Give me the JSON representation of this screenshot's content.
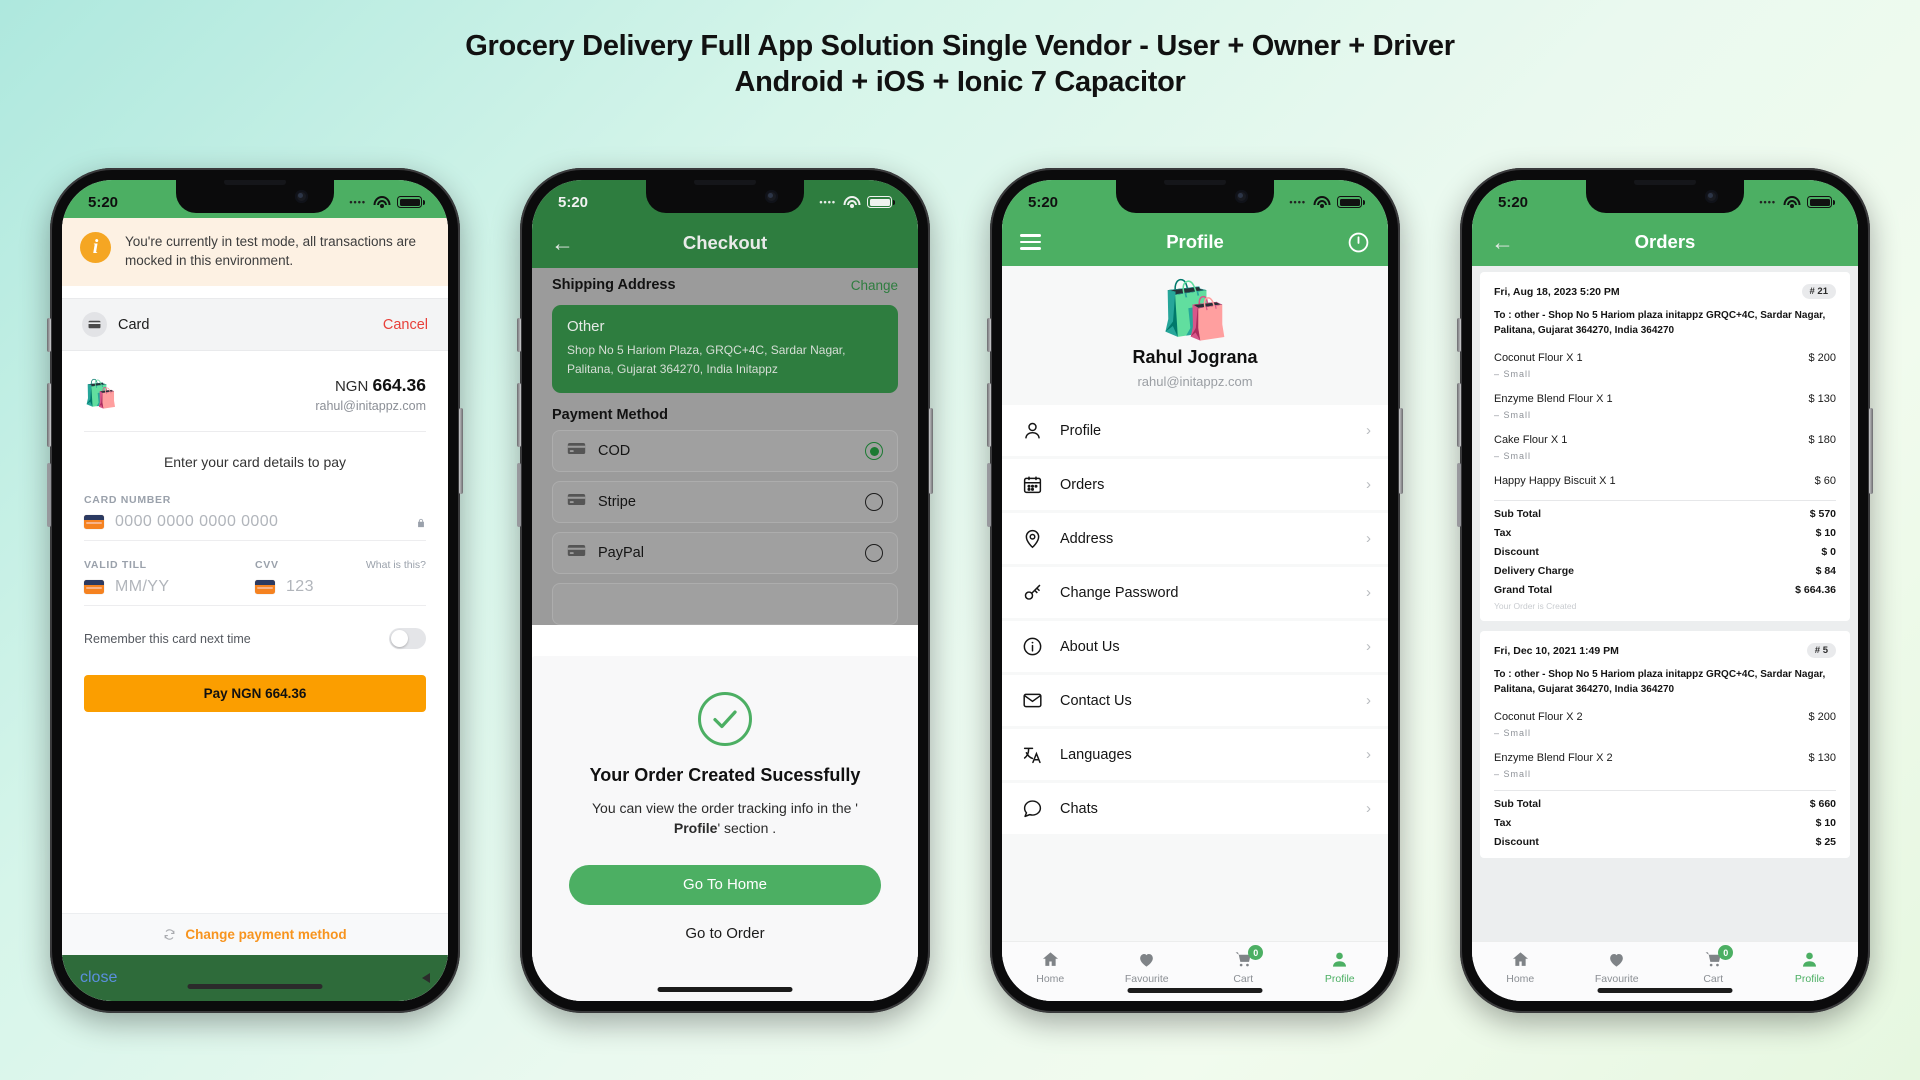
{
  "heading": {
    "line1": "Grocery Delivery Full App Solution Single Vendor - User + Owner + Driver",
    "line2": "Android + iOS + Ionic 7 Capacitor"
  },
  "colors": {
    "brand_green": "#4caf63",
    "dark_green": "#2e7d3f",
    "orange": "#fb9e00",
    "link_orange": "#f7941e",
    "red": "#e8403a"
  },
  "status_bar": {
    "time": "5:20"
  },
  "phone1": {
    "test_mode_notice": "You're currently in test mode, all transactions are mocked in this environment.",
    "method_label": "Card",
    "cancel_label": "Cancel",
    "currency": "NGN",
    "amount": "664.36",
    "email": "rahul@initappz.com",
    "enter_details": "Enter your card details to pay",
    "card_number_label": "CARD NUMBER",
    "card_number_placeholder": "0000 0000 0000 0000",
    "valid_till_label": "VALID TILL",
    "valid_till_placeholder": "MM/YY",
    "cvv_label": "CVV",
    "cvv_placeholder": "123",
    "what_is_this": "What is this?",
    "remember_label": "Remember this card next time",
    "pay_button": "Pay NGN 664.36",
    "change_payment_method": "Change payment method",
    "close_label": "close"
  },
  "phone2": {
    "title": "Checkout",
    "shipping_address_label": "Shipping Address",
    "change_label": "Change",
    "address": {
      "type": "Other",
      "line1": "Shop No 5 Hariom Plaza, GRQC+4C, Sardar Nagar,",
      "line2": "Palitana, Gujarat 364270, India Initappz"
    },
    "payment_method_label": "Payment Method",
    "payment_methods": [
      {
        "label": "COD",
        "selected": true
      },
      {
        "label": "Stripe",
        "selected": false
      },
      {
        "label": "PayPal",
        "selected": false
      }
    ],
    "modal": {
      "title": "Your Order Created Sucessfully",
      "body_1": "You can view the order tracking info in the '",
      "body_bold": "Profile",
      "body_2": "' section .",
      "primary_button": "Go To Home",
      "secondary_button": "Go to Order"
    }
  },
  "phone3": {
    "title": "Profile",
    "user_name": "Rahul Jograna",
    "user_email": "rahul@initappz.com",
    "menu": [
      {
        "label": "Profile",
        "icon": "user-icon"
      },
      {
        "label": "Orders",
        "icon": "calendar-icon"
      },
      {
        "label": "Address",
        "icon": "location-pin-icon"
      },
      {
        "label": "Change Password",
        "icon": "key-icon"
      },
      {
        "label": "About Us",
        "icon": "info-icon"
      },
      {
        "label": "Contact Us",
        "icon": "mail-icon"
      },
      {
        "label": "Languages",
        "icon": "translate-icon"
      },
      {
        "label": "Chats",
        "icon": "chat-icon"
      }
    ],
    "tabs": [
      {
        "label": "Home",
        "icon": "home-icon",
        "badge": "",
        "active": false
      },
      {
        "label": "Favourite",
        "icon": "heart-icon",
        "badge": "",
        "active": false
      },
      {
        "label": "Cart",
        "icon": "cart-icon",
        "badge": "0",
        "active": false
      },
      {
        "label": "Profile",
        "icon": "person-icon",
        "badge": "",
        "active": true
      }
    ]
  },
  "phone4": {
    "title": "Orders",
    "orders": [
      {
        "date": "Fri, Aug 18, 2023 5:20 PM",
        "number": "# 21",
        "to_line1": "To : other - Shop No 5 Hariom plaza initappz GRQC+4C, Sardar Nagar,",
        "to_line2": "Palitana, Gujarat 364270, India 364270",
        "items": [
          {
            "name": "Coconut Flour X 1",
            "size": "–  Small",
            "price": "$ 200"
          },
          {
            "name": "Enzyme Blend Flour X 1",
            "size": "–  Small",
            "price": "$ 130"
          },
          {
            "name": "Cake Flour X 1",
            "size": "–  Small",
            "price": "$ 180"
          },
          {
            "name": "Happy Happy Biscuit X 1",
            "size": "",
            "price": "$ 60"
          }
        ],
        "summary": [
          {
            "key": "Sub Total",
            "value": "$ 570"
          },
          {
            "key": "Tax",
            "value": "$ 10"
          },
          {
            "key": "Discount",
            "value": "$ 0"
          },
          {
            "key": "Delivery Charge",
            "value": "$ 84"
          },
          {
            "key": "Grand Total",
            "value": "$ 664.36"
          }
        ],
        "status": "Your Order is Created"
      },
      {
        "date": "Fri, Dec 10, 2021 1:49 PM",
        "number": "# 5",
        "to_line1": "To : other - Shop No 5 Hariom plaza initappz GRQC+4C, Sardar Nagar,",
        "to_line2": "Palitana, Gujarat 364270, India 364270",
        "items": [
          {
            "name": "Coconut Flour X 2",
            "size": "–  Small",
            "price": "$ 200"
          },
          {
            "name": "Enzyme Blend Flour X 2",
            "size": "–  Small",
            "price": "$ 130"
          }
        ],
        "summary": [
          {
            "key": "Sub Total",
            "value": "$ 660"
          },
          {
            "key": "Tax",
            "value": "$ 10"
          },
          {
            "key": "Discount",
            "value": "$ 25"
          }
        ],
        "status": ""
      }
    ],
    "tabs": [
      {
        "label": "Home",
        "icon": "home-icon",
        "badge": "",
        "active": false
      },
      {
        "label": "Favourite",
        "icon": "heart-icon",
        "badge": "",
        "active": false
      },
      {
        "label": "Cart",
        "icon": "cart-icon",
        "badge": "0",
        "active": false
      },
      {
        "label": "Profile",
        "icon": "person-icon",
        "badge": "",
        "active": true
      }
    ]
  }
}
